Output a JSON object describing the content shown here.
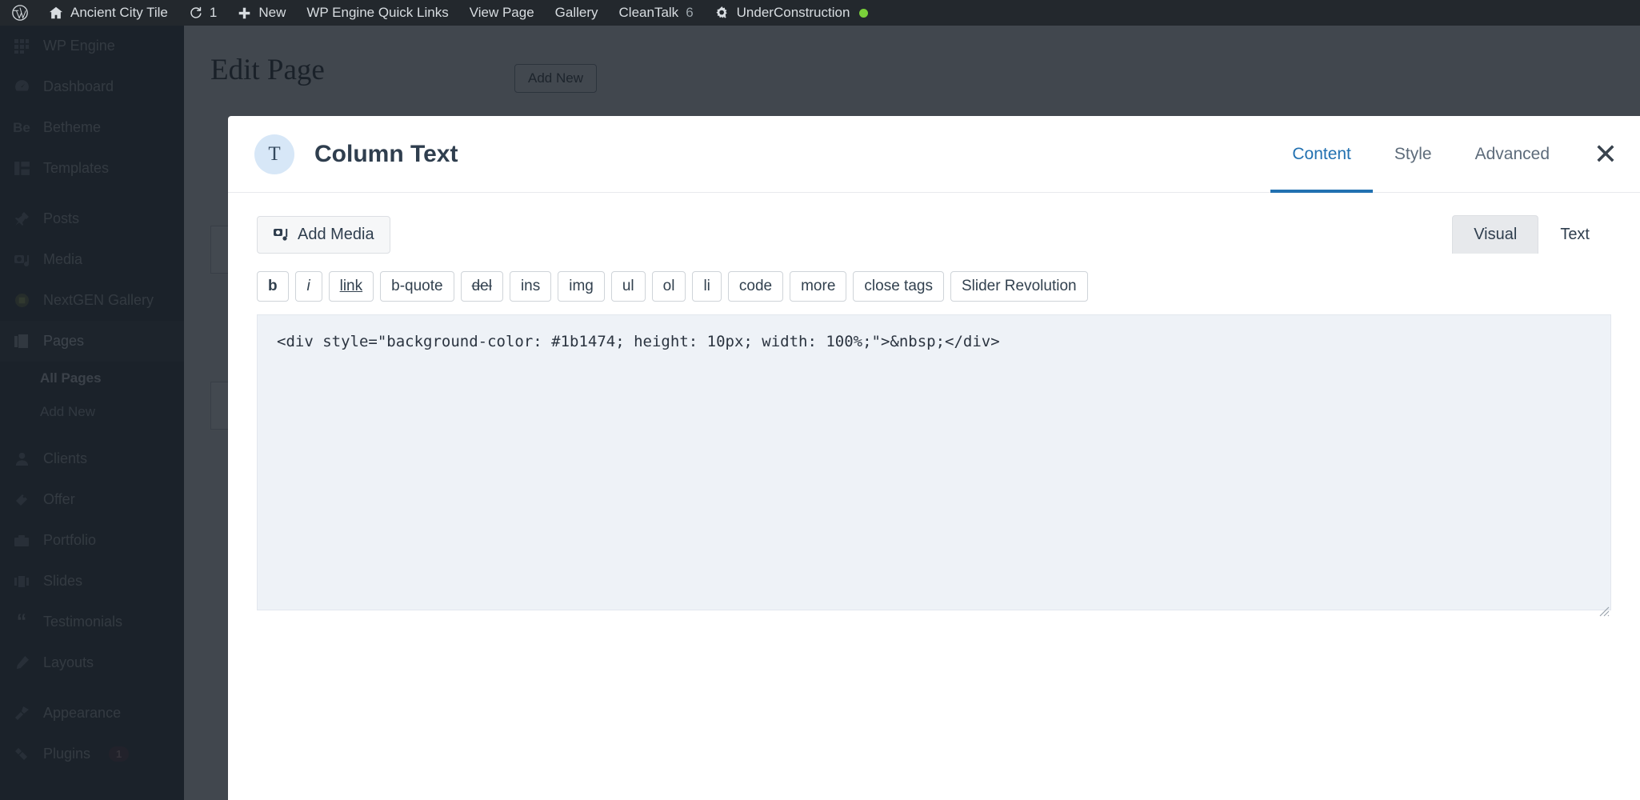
{
  "adminbar": {
    "items": [
      {
        "name": "wordpress-logo",
        "icon": "wordpress-icon",
        "label": ""
      },
      {
        "name": "site-name",
        "icon": "home-icon",
        "label": "Ancient City Tile"
      },
      {
        "name": "updates",
        "icon": "updates-icon",
        "label": "1"
      },
      {
        "name": "new-content",
        "icon": "plus-icon",
        "label": "New"
      },
      {
        "name": "wp-engine-quick-links",
        "icon": "",
        "label": "WP Engine Quick Links"
      },
      {
        "name": "view-page",
        "icon": "",
        "label": "View Page"
      },
      {
        "name": "gallery",
        "icon": "",
        "label": "Gallery"
      },
      {
        "name": "cleantalk",
        "icon": "",
        "label": "CleanTalk",
        "count": "6"
      },
      {
        "name": "underconstruction",
        "icon": "gear-search-icon",
        "label": "UnderConstruction",
        "status": "online"
      }
    ]
  },
  "sidebar": {
    "items": [
      {
        "label": "WP Engine",
        "icon": "grid-icon"
      },
      {
        "label": "Dashboard",
        "icon": "dashboard-icon"
      },
      {
        "label": "Betheme",
        "icon": "be-icon"
      },
      {
        "label": "Templates",
        "icon": "templates-icon"
      },
      {
        "label": "Posts",
        "icon": "pin-icon"
      },
      {
        "label": "Media",
        "icon": "camera-icon"
      },
      {
        "label": "NextGEN Gallery",
        "icon": "nextgen-icon"
      },
      {
        "label": "Pages",
        "icon": "pages-icon",
        "active": true
      },
      {
        "label": "Clients",
        "icon": "user-icon"
      },
      {
        "label": "Offer",
        "icon": "tag-icon"
      },
      {
        "label": "Portfolio",
        "icon": "portfolio-icon"
      },
      {
        "label": "Slides",
        "icon": "slides-icon"
      },
      {
        "label": "Testimonials",
        "icon": "quote-icon"
      },
      {
        "label": "Layouts",
        "icon": "pencil-icon"
      },
      {
        "label": "Appearance",
        "icon": "brush-icon"
      },
      {
        "label": "Plugins",
        "icon": "plug-icon",
        "badge": "1"
      }
    ],
    "submenu": [
      {
        "label": "All Pages",
        "current": true
      },
      {
        "label": "Add New"
      }
    ]
  },
  "page": {
    "title": "Edit Page",
    "add_new_label": "Add New"
  },
  "modal": {
    "badge_letter": "T",
    "title": "Column Text",
    "tabs": [
      {
        "label": "Content",
        "active": true
      },
      {
        "label": "Style",
        "active": false
      },
      {
        "label": "Advanced",
        "active": false
      }
    ],
    "close_label": "✕"
  },
  "editor": {
    "add_media_label": "Add Media",
    "mode_visual": "Visual",
    "mode_text": "Text",
    "active_mode": "Visual",
    "quicktags": [
      "b",
      "i",
      "link",
      "b-quote",
      "del",
      "ins",
      "img",
      "ul",
      "ol",
      "li",
      "code",
      "more",
      "close tags",
      "Slider Revolution"
    ],
    "code": "<div style=\"background-color: #1b1474; height: 10px; width: 100%;\">&nbsp;</div>"
  },
  "colors": {
    "admin_dark": "#23282d",
    "accent_blue": "#2271b1",
    "badge_red": "#d63638",
    "status_green": "#7ad03a",
    "code_bg": "#eef2f7"
  }
}
